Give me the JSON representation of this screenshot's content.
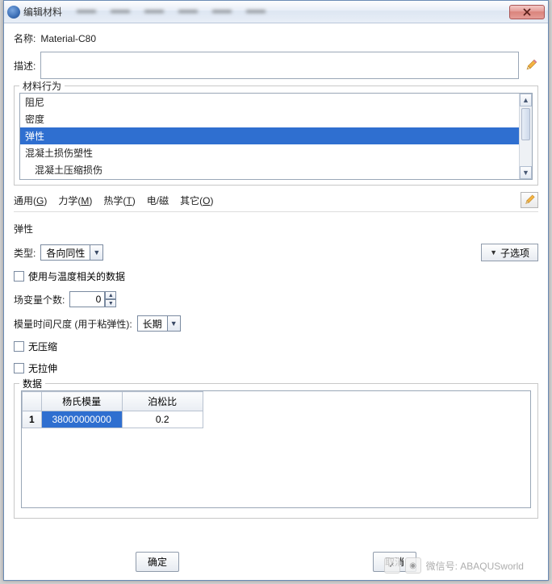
{
  "window": {
    "title": "编辑材料"
  },
  "labels": {
    "name": "名称:",
    "desc": "描述:"
  },
  "values": {
    "name": "Material-C80"
  },
  "behaviors": {
    "legend": "材料行为",
    "items": [
      "阻尼",
      "密度",
      "弹性",
      "混凝土损伤塑性",
      "混凝土压缩损伤"
    ],
    "selectedIndex": 2
  },
  "menu": {
    "general": "通用",
    "g": "G",
    "mech": "力学",
    "m": "M",
    "thermal": "热学",
    "t": "T",
    "em": "电/磁",
    "other": "其它",
    "o": "O"
  },
  "section": {
    "title": "弹性"
  },
  "params": {
    "type_label": "类型:",
    "type_value": "各向同性",
    "suboptions": "子选项",
    "tempdata": "使用与温度相关的数据",
    "fieldvar_label": "场变量个数:",
    "fieldvar_value": "0",
    "moduli_label": "模量时间尺度 (用于粘弹性):",
    "moduli_value": "长期",
    "nocomp": "无压缩",
    "noten": "无拉伸"
  },
  "data": {
    "legend": "数据",
    "headers": [
      "杨氏模量",
      "泊松比"
    ],
    "rows": [
      [
        "38000000000",
        "0.2"
      ]
    ]
  },
  "footer": {
    "ok": "确定",
    "cancel": "取消"
  },
  "watermark": {
    "label": "微信号: ABAQUSworld"
  }
}
